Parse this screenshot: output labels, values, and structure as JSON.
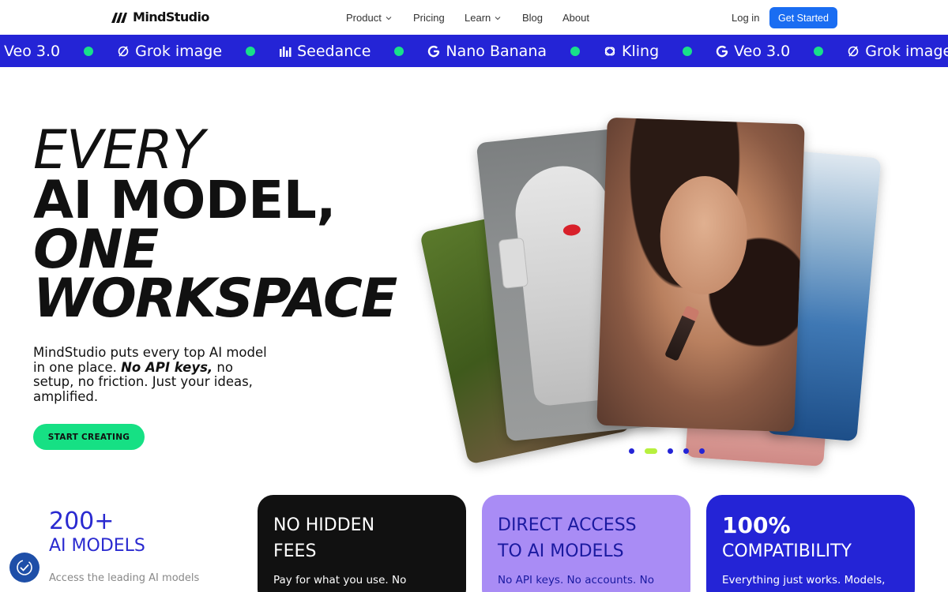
{
  "brand": {
    "name": "MindStudio"
  },
  "nav": {
    "items": [
      {
        "label": "Product",
        "has_dropdown": true
      },
      {
        "label": "Pricing",
        "has_dropdown": false
      },
      {
        "label": "Learn",
        "has_dropdown": true
      },
      {
        "label": "Blog",
        "has_dropdown": false
      },
      {
        "label": "About",
        "has_dropdown": false
      }
    ],
    "login": "Log in",
    "cta": "Get Started"
  },
  "ticker": {
    "items": [
      {
        "label": "Veo 3.0",
        "icon": "none"
      },
      {
        "label": "Grok image",
        "icon": "grok-icon"
      },
      {
        "label": "Seedance",
        "icon": "seedance-icon"
      },
      {
        "label": "Nano Banana",
        "icon": "google-icon"
      },
      {
        "label": "Kling",
        "icon": "kling-icon"
      },
      {
        "label": "Veo 3.0",
        "icon": "google-icon"
      },
      {
        "label": "Grok image",
        "icon": "grok-icon"
      }
    ]
  },
  "hero": {
    "line1": "EVERY",
    "line2": "AI MODEL,",
    "line3": "ONE",
    "line4": "WORKSPACE",
    "copy_before": "MindStudio puts every top AI model in one place. ",
    "copy_bold": "No API keys,",
    "copy_after": " no setup, no friction. Just your ideas, amplified.",
    "cta": "START CREATING"
  },
  "carousel": {
    "slide_count": 5,
    "active_index": 1
  },
  "stats": {
    "plain": {
      "big": "200+",
      "sub": "AI MODELS",
      "desc": "Access the leading AI models"
    },
    "black": {
      "t1": "NO HIDDEN",
      "t2": "FEES",
      "desc": "Pay for what you use. No"
    },
    "purple": {
      "t1": "DIRECT ACCESS",
      "t2": "TO AI MODELS",
      "desc": "No API keys. No accounts. No"
    },
    "blue": {
      "t1": "100%",
      "t2": "COMPATIBILITY",
      "desc": "Everything just works. Models,"
    }
  },
  "colors": {
    "accent_blue": "#2424d6",
    "button_blue": "#1a6df2",
    "green": "#16e084",
    "purple": "#a98cf5",
    "black": "#111111"
  }
}
